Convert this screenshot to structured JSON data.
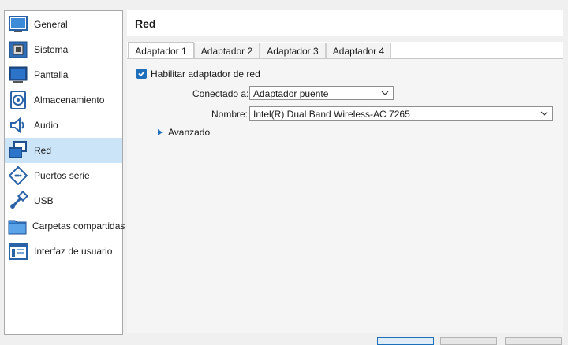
{
  "sidebar": {
    "items": [
      {
        "label": "General",
        "icon": "general-icon"
      },
      {
        "label": "Sistema",
        "icon": "system-icon"
      },
      {
        "label": "Pantalla",
        "icon": "display-icon"
      },
      {
        "label": "Almacenamiento",
        "icon": "storage-icon"
      },
      {
        "label": "Audio",
        "icon": "audio-icon"
      },
      {
        "label": "Red",
        "icon": "network-icon",
        "selected": true
      },
      {
        "label": "Puertos serie",
        "icon": "serial-ports-icon"
      },
      {
        "label": "USB",
        "icon": "usb-icon"
      },
      {
        "label": "Carpetas compartidas",
        "icon": "shared-folders-icon"
      },
      {
        "label": "Interfaz de usuario",
        "icon": "user-interface-icon"
      }
    ]
  },
  "header": {
    "title": "Red"
  },
  "tabs": [
    {
      "label": "Adaptador 1",
      "active": true
    },
    {
      "label": "Adaptador 2"
    },
    {
      "label": "Adaptador 3"
    },
    {
      "label": "Adaptador 4"
    }
  ],
  "adapter": {
    "enable_label": "Habilitar adaptador de red",
    "enabled": true,
    "attached_label": "Conectado a:",
    "attached_value": "Adaptador puente",
    "name_label": "Nombre:",
    "name_value": "Intel(R) Dual Band Wireless-AC 7265",
    "advanced_label": "Avanzado"
  },
  "colors": {
    "accent": "#1e6fb9",
    "selected_bg": "#cce4f7"
  }
}
